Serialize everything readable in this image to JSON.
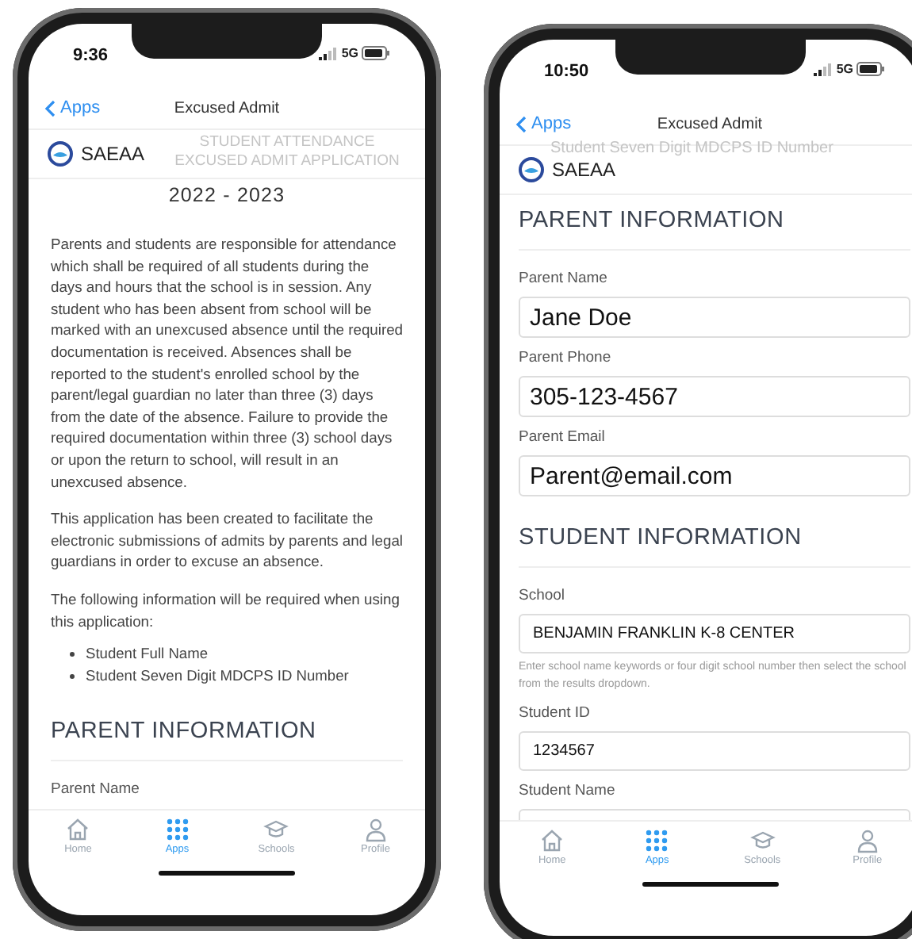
{
  "phones": [
    {
      "status_bar": {
        "time": "9:36",
        "network": "5G"
      },
      "nav": {
        "back": "Apps",
        "title": "Excused Admit"
      },
      "header": {
        "logo_text": "SAEAA",
        "behind": "STUDENT ATTENDANCE EXCUSED ADMIT APPLICATION"
      },
      "content": [
        {
          "kind": "year",
          "text": "2022 - 2023"
        },
        {
          "kind": "paragraph",
          "text": "Parents and students are responsible for attendance which shall be required of all students during the days and hours that the school is in session. Any student who has been absent from school will be marked with an unexcused absence until the required documentation is received. Absences shall be reported to the student's enrolled school by the parent/legal guardian no later than three (3) days from the date of the absence. Failure to provide the required documentation within three (3) school days or upon the return to school, will result in an unexcused absence."
        },
        {
          "kind": "paragraph",
          "text": "This application has been created to facilitate the electronic submissions of admits by parents and legal guardians in order to excuse an absence."
        },
        {
          "kind": "paragraph",
          "text": "The following information will be required when using this application:"
        },
        {
          "kind": "bullets",
          "items": [
            "Student Full Name",
            "Student Seven Digit MDCPS ID Number"
          ]
        },
        {
          "kind": "section",
          "text": "PARENT INFORMATION"
        },
        {
          "kind": "label",
          "text": "Parent Name"
        }
      ],
      "tabs": [
        {
          "label": "Home",
          "selected": false
        },
        {
          "label": "Apps",
          "selected": true
        },
        {
          "label": "Schools",
          "selected": false
        },
        {
          "label": "Profile",
          "selected": false
        }
      ]
    },
    {
      "status_bar": {
        "time": "10:50",
        "network": "5G"
      },
      "nav": {
        "back": "Apps",
        "title": "Excused Admit"
      },
      "header": {
        "logo_text": "SAEAA",
        "behind": "Student Seven Digit MDCPS ID Number"
      },
      "content": [
        {
          "kind": "section",
          "text": "PARENT INFORMATION"
        },
        {
          "kind": "label",
          "text": "Parent Name"
        },
        {
          "kind": "big_field",
          "value": "Jane Doe"
        },
        {
          "kind": "label",
          "text": "Parent Phone"
        },
        {
          "kind": "big_field",
          "value": "305-123-4567"
        },
        {
          "kind": "label",
          "text": "Parent Email"
        },
        {
          "kind": "big_field",
          "value": "Parent@email.com"
        },
        {
          "kind": "section",
          "text": "STUDENT INFORMATION"
        },
        {
          "kind": "label",
          "text": "School"
        },
        {
          "kind": "field",
          "value": "BENJAMIN FRANKLIN K-8 CENTER"
        },
        {
          "kind": "hint",
          "text": "Enter school name keywords or four digit school number then select the school from the results dropdown."
        },
        {
          "kind": "label",
          "text": "Student ID"
        },
        {
          "kind": "field",
          "value": "1234567"
        },
        {
          "kind": "label",
          "text": "Student Name"
        },
        {
          "kind": "field"
        }
      ],
      "tabs": [
        {
          "label": "Home",
          "selected": false
        },
        {
          "label": "Apps",
          "selected": true
        },
        {
          "label": "Schools",
          "selected": false
        },
        {
          "label": "Profile",
          "selected": false
        }
      ]
    }
  ]
}
